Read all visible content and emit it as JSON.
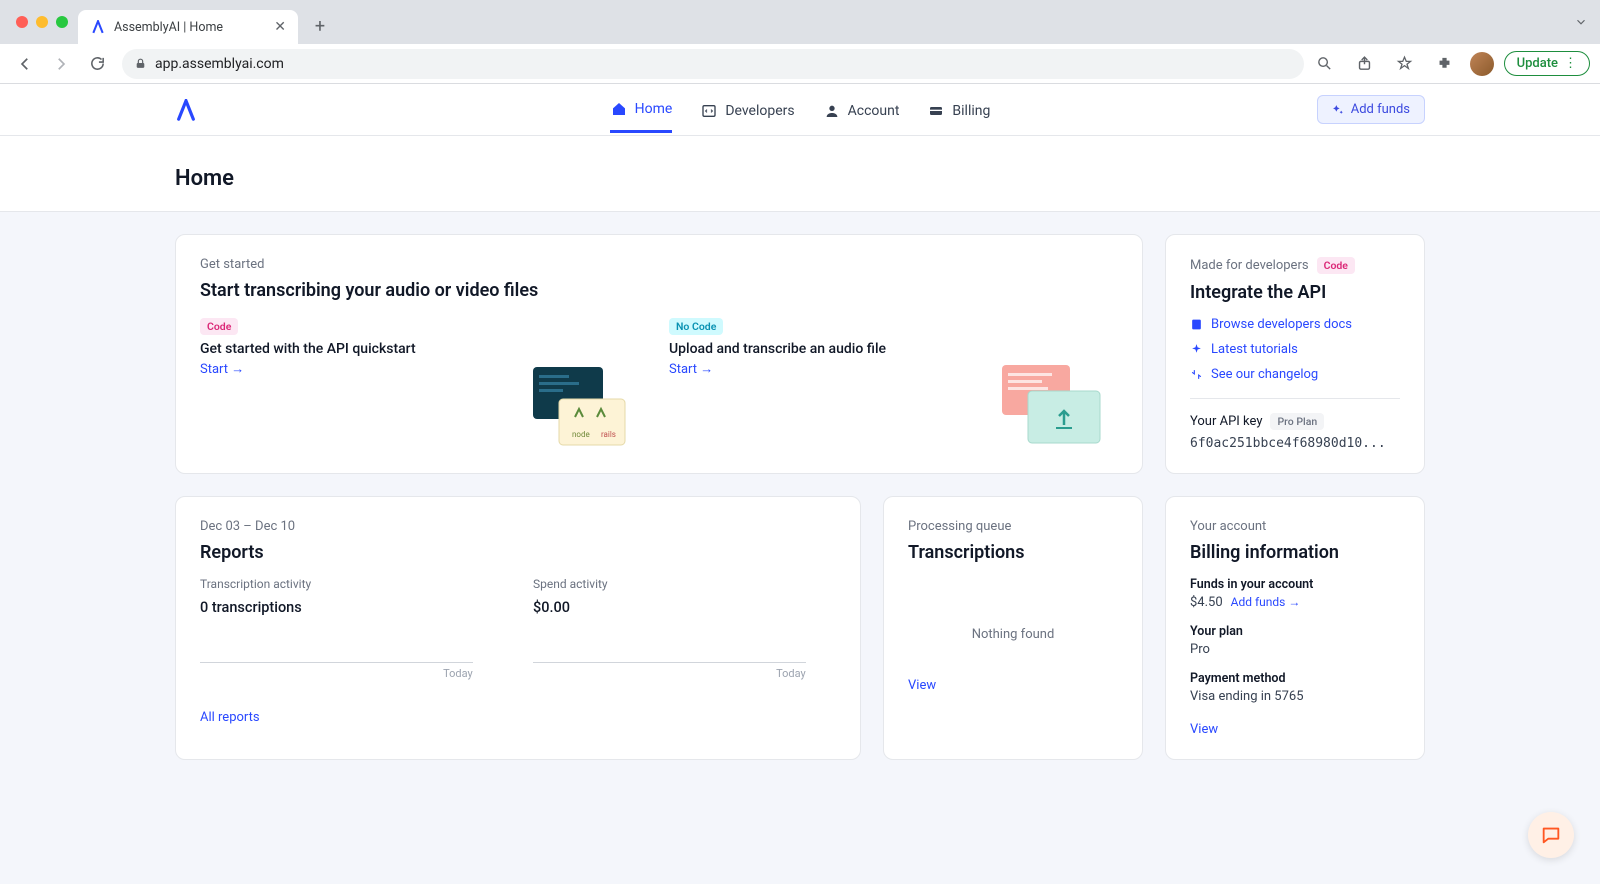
{
  "browser": {
    "tab_title": "AssemblyAI | Home",
    "url": "app.assemblyai.com",
    "update_label": "Update"
  },
  "header": {
    "nav": {
      "home": "Home",
      "developers": "Developers",
      "account": "Account",
      "billing": "Billing"
    },
    "add_funds": "Add funds"
  },
  "page": {
    "title": "Home"
  },
  "get_started": {
    "label": "Get started",
    "title": "Start transcribing your audio or video files",
    "left": {
      "badge": "Code",
      "title": "Get started with the API quickstart",
      "link": "Start →"
    },
    "right": {
      "badge": "No Code",
      "title": "Upload and transcribe an audio file",
      "link": "Start →"
    }
  },
  "api_side": {
    "label": "Made for developers",
    "badge": "Code",
    "title": "Integrate the API",
    "links": {
      "docs": "Browse developers docs",
      "tutorials": "Latest tutorials",
      "changelog": "See our changelog"
    },
    "api_key_label": "Your API key",
    "plan_badge": "Pro Plan",
    "api_key_value": "6f0ac251bbce4f68980d10..."
  },
  "reports": {
    "date_range": "Dec 03 – Dec 10",
    "title": "Reports",
    "transcription": {
      "label": "Transcription activity",
      "value": "0 transcriptions",
      "x": "Today"
    },
    "spend": {
      "label": "Spend activity",
      "value": "$0.00",
      "x": "Today"
    },
    "all_link": "All reports"
  },
  "queue": {
    "label": "Processing queue",
    "title": "Transcriptions",
    "empty": "Nothing found",
    "view": "View"
  },
  "billing": {
    "label": "Your account",
    "title": "Billing information",
    "funds": {
      "label": "Funds in your account",
      "value": "$4.50",
      "link": "Add funds →"
    },
    "plan": {
      "label": "Your plan",
      "value": "Pro"
    },
    "payment": {
      "label": "Payment method",
      "value": "Visa ending in 5765"
    },
    "view": "View"
  }
}
